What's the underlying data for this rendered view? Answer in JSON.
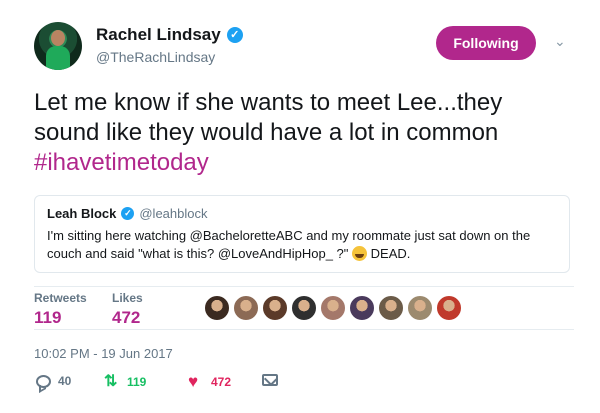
{
  "author": {
    "display_name": "Rachel Lindsay",
    "handle": "@TheRachLindsay",
    "verified_icon": "verified-badge-icon"
  },
  "follow_button": {
    "label": "Following",
    "color": "#b1278c"
  },
  "tweet": {
    "text": "Let me know if she wants to meet Lee...they sound like they would have a lot in common",
    "hashtag": "#ihavetimetoday",
    "hashtag_color": "#b1278c"
  },
  "quoted_tweet": {
    "display_name": "Leah Block",
    "handle": "@leahblock",
    "text_before_emoji": "I'm sitting here watching @BacheloretteABC and my roommate just sat down on the couch and said \"what is this? @LoveAndHipHop_ ?\"",
    "emoji": "face-with-tears-of-joy",
    "text_after_emoji": "DEAD."
  },
  "stats": {
    "retweets_label": "Retweets",
    "retweets_value": "119",
    "likes_label": "Likes",
    "likes_value": "472",
    "liker_avatar_colors": [
      "#3b2a20",
      "#8c6a55",
      "#5b3a29",
      "#2f2f2f",
      "#a4786a",
      "#4a3a5c",
      "#6b5b48",
      "#9c8a6e",
      "#c0392b"
    ]
  },
  "timestamp": "10:02 PM - 19 Jun 2017",
  "actions": {
    "reply_count": "40",
    "retweet_count": "119",
    "like_count": "472",
    "retweet_color": "#17bf63",
    "like_color": "#e0245e"
  }
}
